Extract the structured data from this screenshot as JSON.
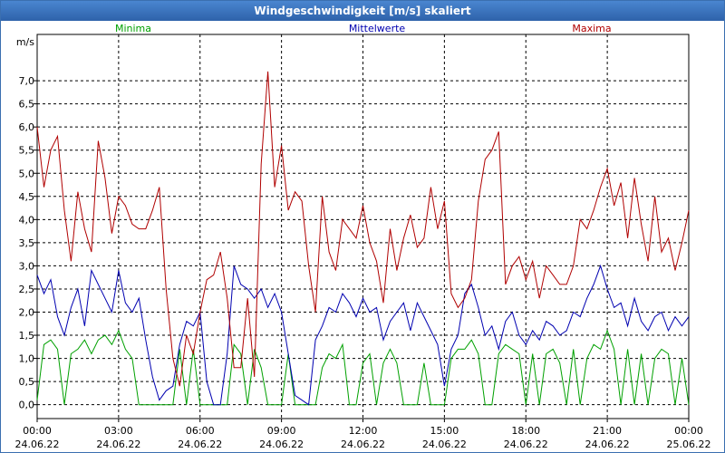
{
  "title": "Windgeschwindigkeit [m/s] skaliert",
  "chart_data": {
    "type": "line",
    "title": "Windgeschwindigkeit [m/s] skaliert",
    "ylabel": "m/s",
    "ylim": [
      -0.3,
      8.0
    ],
    "yticks": [
      "0,0",
      "0,5",
      "1,0",
      "1,5",
      "2,0",
      "2,5",
      "3,0",
      "3,5",
      "4,0",
      "4,5",
      "5,0",
      "5,5",
      "6,0",
      "6,5",
      "7,0"
    ],
    "xticks": [
      {
        "time": "00:00",
        "date": "24.06.22"
      },
      {
        "time": "03:00",
        "date": "24.06.22"
      },
      {
        "time": "06:00",
        "date": "24.06.22"
      },
      {
        "time": "09:00",
        "date": "24.06.22"
      },
      {
        "time": "12:00",
        "date": "24.06.22"
      },
      {
        "time": "15:00",
        "date": "24.06.22"
      },
      {
        "time": "18:00",
        "date": "24.06.22"
      },
      {
        "time": "21:00",
        "date": "24.06.22"
      },
      {
        "time": "00:00",
        "date": "25.06.22"
      }
    ],
    "x_hours": [
      0,
      0.25,
      0.5,
      0.75,
      1,
      1.25,
      1.5,
      1.75,
      2,
      2.25,
      2.5,
      2.75,
      3,
      3.25,
      3.5,
      3.75,
      4,
      4.25,
      4.5,
      4.75,
      5,
      5.25,
      5.5,
      5.75,
      6,
      6.25,
      6.5,
      6.75,
      7,
      7.25,
      7.5,
      7.75,
      8,
      8.25,
      8.5,
      8.75,
      9,
      9.25,
      9.5,
      9.75,
      10,
      10.25,
      10.5,
      10.75,
      11,
      11.25,
      11.5,
      11.75,
      12,
      12.25,
      12.5,
      12.75,
      13,
      13.25,
      13.5,
      13.75,
      14,
      14.25,
      14.5,
      14.75,
      15,
      15.25,
      15.5,
      15.75,
      16,
      16.25,
      16.5,
      16.75,
      17,
      17.25,
      17.5,
      17.75,
      18,
      18.25,
      18.5,
      18.75,
      19,
      19.25,
      19.5,
      19.75,
      20,
      20.25,
      20.5,
      20.75,
      21,
      21.25,
      21.5,
      21.75,
      22,
      22.25,
      22.5,
      22.75,
      23,
      23.25,
      23.5,
      23.75,
      24
    ],
    "series": [
      {
        "name": "Minima",
        "color": "#00a000",
        "values": [
          0.1,
          1.3,
          1.4,
          1.2,
          0.0,
          1.1,
          1.2,
          1.4,
          1.1,
          1.4,
          1.5,
          1.3,
          1.6,
          1.2,
          1.0,
          0.0,
          0.0,
          0.0,
          0.0,
          0.0,
          0.0,
          1.2,
          0.0,
          1.2,
          0.0,
          0.0,
          0.0,
          0.0,
          0.0,
          1.3,
          1.1,
          0.0,
          1.2,
          0.8,
          0.0,
          0.0,
          0.0,
          1.1,
          0.0,
          0.0,
          0.0,
          0.0,
          0.8,
          1.1,
          1.0,
          1.3,
          0.0,
          0.0,
          0.9,
          1.1,
          0.0,
          0.9,
          1.2,
          0.9,
          0.0,
          0.0,
          0.0,
          0.9,
          0.0,
          0.0,
          0.0,
          1.0,
          1.2,
          1.2,
          1.4,
          1.1,
          0.0,
          0.0,
          1.1,
          1.3,
          1.2,
          1.1,
          0.0,
          1.1,
          0.0,
          1.1,
          1.2,
          0.9,
          0.0,
          1.2,
          0.0,
          1.0,
          1.3,
          1.2,
          1.6,
          1.2,
          0.0,
          1.2,
          0.0,
          1.1,
          0.0,
          1.0,
          1.2,
          1.1,
          0.0,
          1.0,
          0.0,
          1.1,
          0.0
        ]
      },
      {
        "name": "Mittelwerte",
        "color": "#0000b0",
        "values": [
          2.8,
          2.4,
          2.7,
          1.9,
          1.5,
          2.1,
          2.5,
          1.7,
          2.9,
          2.6,
          2.3,
          2.0,
          2.9,
          2.2,
          2.0,
          2.3,
          1.4,
          0.6,
          0.1,
          0.3,
          0.4,
          1.3,
          1.8,
          1.7,
          2.0,
          0.5,
          0.0,
          0.0,
          1.1,
          3.0,
          2.6,
          2.5,
          2.3,
          2.5,
          2.1,
          2.4,
          2.0,
          1.1,
          0.2,
          0.1,
          0.0,
          1.4,
          1.7,
          2.1,
          2.0,
          2.4,
          2.2,
          1.9,
          2.3,
          2.0,
          2.1,
          1.4,
          1.8,
          2.0,
          2.2,
          1.6,
          2.2,
          1.9,
          1.6,
          1.3,
          0.4,
          1.2,
          1.5,
          2.4,
          2.6,
          2.1,
          1.5,
          1.7,
          1.2,
          1.8,
          2.0,
          1.5,
          1.3,
          1.6,
          1.4,
          1.8,
          1.7,
          1.5,
          1.6,
          2.0,
          1.9,
          2.3,
          2.6,
          3.0,
          2.5,
          2.1,
          2.2,
          1.7,
          2.3,
          1.8,
          1.6,
          1.9,
          2.0,
          1.6,
          1.9,
          1.7,
          1.9,
          1.8,
          1.6
        ]
      },
      {
        "name": "Maxima",
        "color": "#b00000",
        "values": [
          6.0,
          4.7,
          5.5,
          5.8,
          4.2,
          3.1,
          4.6,
          3.8,
          3.3,
          5.7,
          4.9,
          3.7,
          4.5,
          4.3,
          3.9,
          3.8,
          3.8,
          4.2,
          4.7,
          2.5,
          1.0,
          0.4,
          1.5,
          1.1,
          2.0,
          2.7,
          2.8,
          3.3,
          2.3,
          0.8,
          0.8,
          2.3,
          0.6,
          5.2,
          7.2,
          4.7,
          5.6,
          4.2,
          4.6,
          4.4,
          3.0,
          2.0,
          4.5,
          3.3,
          2.9,
          4.0,
          3.8,
          3.6,
          4.3,
          3.5,
          3.1,
          2.2,
          3.8,
          2.9,
          3.6,
          4.1,
          3.4,
          3.6,
          4.7,
          3.8,
          4.4,
          2.4,
          2.1,
          2.3,
          2.7,
          4.4,
          5.3,
          5.5,
          5.9,
          2.6,
          3.0,
          3.2,
          2.7,
          3.1,
          2.3,
          3.0,
          2.8,
          2.6,
          2.6,
          3.0,
          4.0,
          3.8,
          4.2,
          4.7,
          5.1,
          4.3,
          4.8,
          3.6,
          4.9,
          3.9,
          3.1,
          4.5,
          3.3,
          3.6,
          2.9,
          3.5,
          4.2,
          3.0,
          2.9
        ]
      }
    ],
    "grid": true
  }
}
